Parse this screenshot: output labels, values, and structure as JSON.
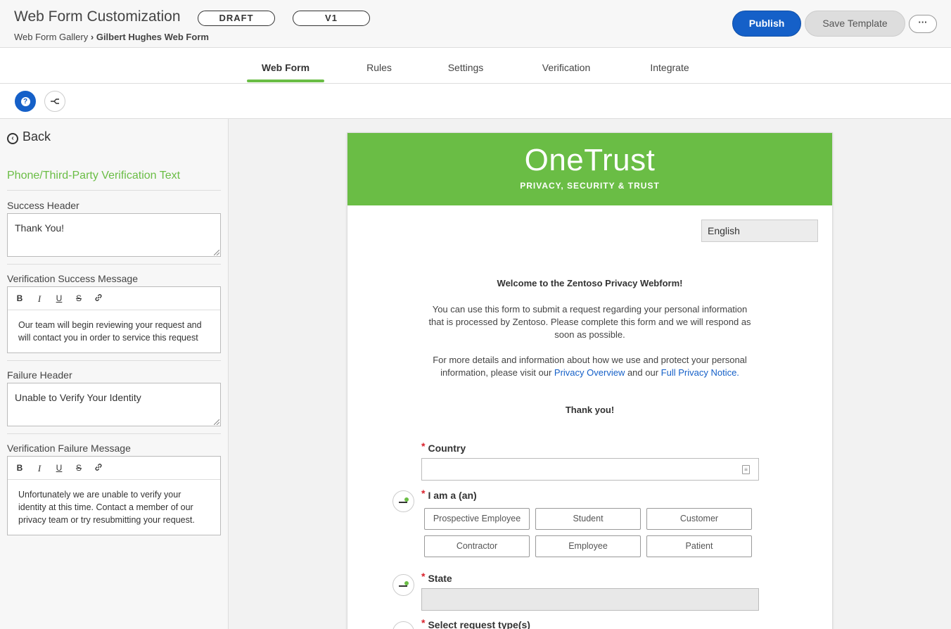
{
  "header": {
    "title": "Web Form Customization",
    "status_pill": "DRAFT",
    "version_pill": "V1",
    "breadcrumb_parent": "Web Form Gallery",
    "breadcrumb_sep": "›",
    "breadcrumb_current": "Gilbert Hughes Web Form",
    "publish_label": "Publish",
    "save_template_label": "Save Template",
    "more_label": "···"
  },
  "tabs": [
    {
      "label": "Web Form",
      "active": true
    },
    {
      "label": "Rules",
      "active": false
    },
    {
      "label": "Settings",
      "active": false
    },
    {
      "label": "Verification",
      "active": false
    },
    {
      "label": "Integrate",
      "active": false
    }
  ],
  "left_panel": {
    "back_label": "Back",
    "section_title": "Phone/Third-Party Verification Text",
    "success_header_label": "Success Header",
    "success_header_value": "Thank You!",
    "success_message_label": "Verification Success Message",
    "success_message_value": "Our team will begin reviewing your request and will contact you in order to service this request",
    "failure_header_label": "Failure Header",
    "failure_header_value": "Unable to Verify Your Identity",
    "failure_message_label": "Verification Failure Message",
    "failure_message_value": "Unfortunately we are unable to verify your identity at this time. Contact a member of our privacy team or try resubmitting your request.",
    "rte_tools": [
      "B",
      "I",
      "U",
      "S",
      "🔗"
    ]
  },
  "form": {
    "brand": "OneTrust",
    "tagline": "PRIVACY, SECURITY & TRUST",
    "language": "English",
    "welcome": "Welcome to the Zentoso Privacy Webform!",
    "para1": "You can use this form to submit a request regarding your personal information that is processed by Zentoso. Please complete this form and we will respond as soon as possible.",
    "para2_prefix": "For more details and information about how we use and protect your personal information, please visit our ",
    "para2_link1": "Privacy Overview",
    "para2_mid": " and our ",
    "para2_link2": "Full Privacy Notice.",
    "thanks": "Thank you!",
    "required_mark": "*",
    "country_label": "Country",
    "iam_label": "I am a (an)",
    "iam_options": [
      "Prospective Employee",
      "Student",
      "Customer",
      "Contractor",
      "Employee",
      "Patient"
    ],
    "state_label": "State",
    "request_label": "Select request type(s)"
  },
  "colors": {
    "brand_green": "#6abd45",
    "primary_blue": "#1560c8",
    "required_red": "#d9212c"
  }
}
